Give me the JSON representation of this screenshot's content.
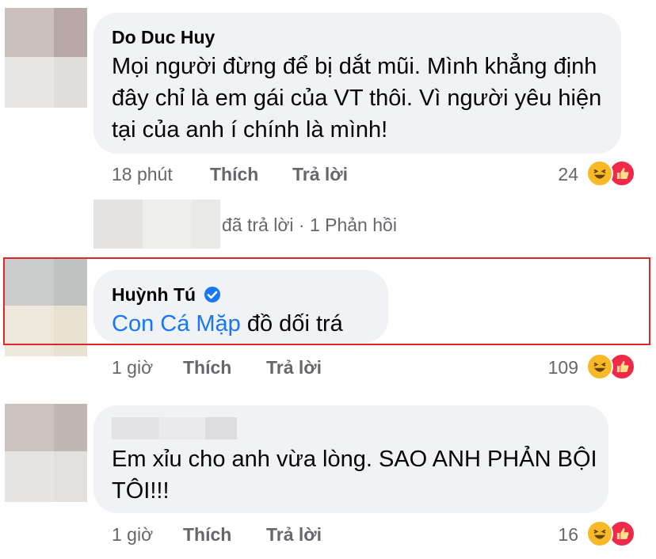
{
  "comments": [
    {
      "author": "Do Duc Huy",
      "text": "Mọi người đừng để bị dắt mũi. Mình khẳng định đây chỉ là em gái của VT thôi. Vì người yêu hiện tại của anh í chính là mình!",
      "time": "18 phút",
      "like_label": "Thích",
      "reply_label": "Trả lời",
      "reaction_count": "24"
    },
    {
      "author": "Huỳnh Tú",
      "verified": true,
      "mention": "Con Cá Mặp",
      "text_after_mention": " đồ dối trá",
      "time": "1 giờ",
      "like_label": "Thích",
      "reply_label": "Trả lời",
      "reaction_count": "109"
    },
    {
      "author": "",
      "text": "Em xỉu cho anh vừa lòng. SAO ANH PHẢN BỘI TÔI!!!",
      "time": "1 giờ",
      "like_label": "Thích",
      "reply_label": "Trả lời",
      "reaction_count": "16"
    }
  ],
  "replies_summary": {
    "text": "đã trả lời · 1 Phản hồi"
  },
  "colors": {
    "bubble": "#f0f2f5",
    "mention": "#1877f2",
    "meta": "#65676b",
    "highlight": "#e0262b",
    "verified": "#1877f2"
  },
  "icons": [
    "laugh-reaction-icon",
    "like-reaction-icon",
    "verified-badge-icon"
  ]
}
